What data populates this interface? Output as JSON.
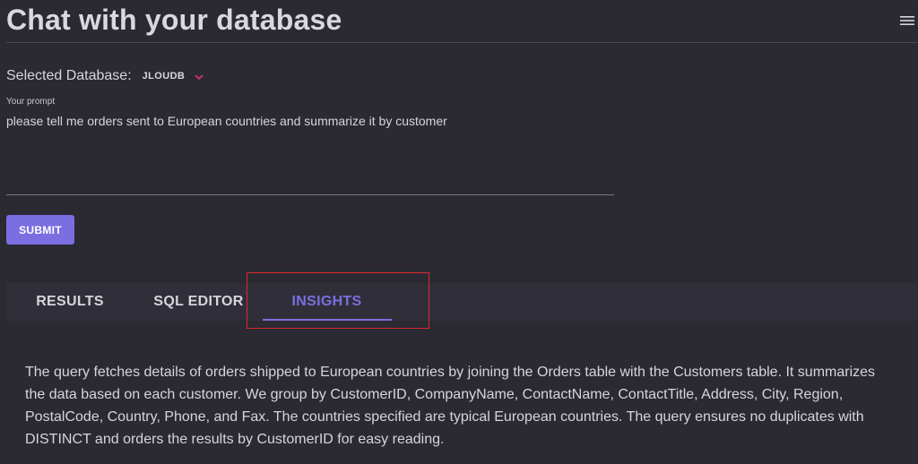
{
  "app": {
    "title": "Chat with your database"
  },
  "header": {
    "menu_icon": "hamburger-menu-icon"
  },
  "database": {
    "label": "Selected Database:",
    "selected": "JLOUDB",
    "chevron_icon": "chevron-down-icon",
    "accent_color": "#e0306a"
  },
  "prompt": {
    "label": "Your prompt",
    "value": "please tell me orders sent to European countries and summarize it by customer"
  },
  "submit": {
    "label": "SUBMIT",
    "color": "#7b6ee0"
  },
  "tabs": [
    {
      "label": "RESULTS",
      "active": false
    },
    {
      "label": "SQL EDITOR",
      "active": false
    },
    {
      "label": "INSIGHTS",
      "active": true
    }
  ],
  "highlight": {
    "color": "#d82a2a"
  },
  "insights": {
    "text": "The query fetches details of orders shipped to European countries by joining the Orders table with the Customers table. It summarizes the data based on each customer. We group by CustomerID, CompanyName, ContactName, ContactTitle, Address, City, Region, PostalCode, Country, Phone, and Fax. The countries specified are typical European countries. The query ensures no duplicates with DISTINCT and orders the results by CustomerID for easy reading."
  }
}
